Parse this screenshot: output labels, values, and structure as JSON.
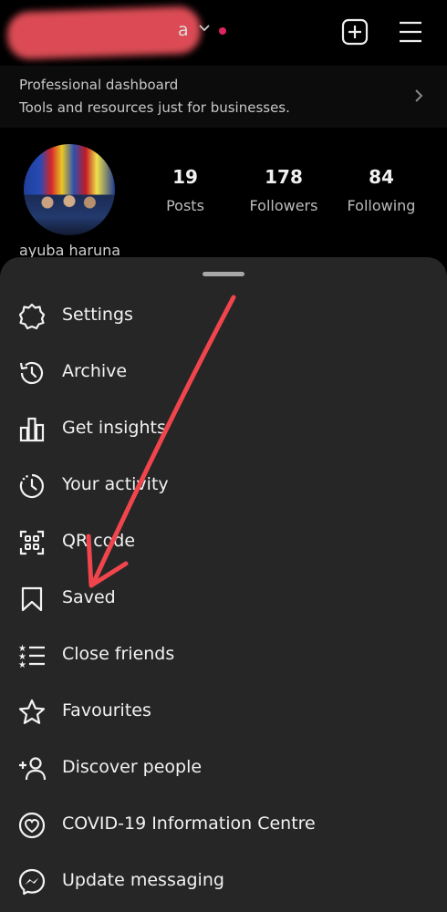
{
  "header": {
    "username_suffix": "a"
  },
  "dashboard": {
    "title": "Professional dashboard",
    "subtitle": "Tools and resources just for businesses."
  },
  "profile": {
    "name": "ayuba haruna",
    "stats": [
      {
        "value": "19",
        "label": "Posts"
      },
      {
        "value": "178",
        "label": "Followers"
      },
      {
        "value": "84",
        "label": "Following"
      }
    ]
  },
  "menu": {
    "items": [
      {
        "label": "Settings",
        "icon": "gear-icon"
      },
      {
        "label": "Archive",
        "icon": "archive-icon"
      },
      {
        "label": "Get insights",
        "icon": "insights-icon"
      },
      {
        "label": "Your activity",
        "icon": "activity-icon"
      },
      {
        "label": "QR code",
        "icon": "qr-code-icon"
      },
      {
        "label": "Saved",
        "icon": "bookmark-icon"
      },
      {
        "label": "Close friends",
        "icon": "close-friends-icon"
      },
      {
        "label": "Favourites",
        "icon": "star-icon"
      },
      {
        "label": "Discover people",
        "icon": "add-person-icon"
      },
      {
        "label": "COVID-19 Information Centre",
        "icon": "covid-heart-icon"
      },
      {
        "label": "Update messaging",
        "icon": "messenger-icon"
      }
    ]
  },
  "colors": {
    "annotation_arrow": "#f0454c",
    "notification_dot": "#e0245e",
    "sheet_background": "#262626"
  }
}
